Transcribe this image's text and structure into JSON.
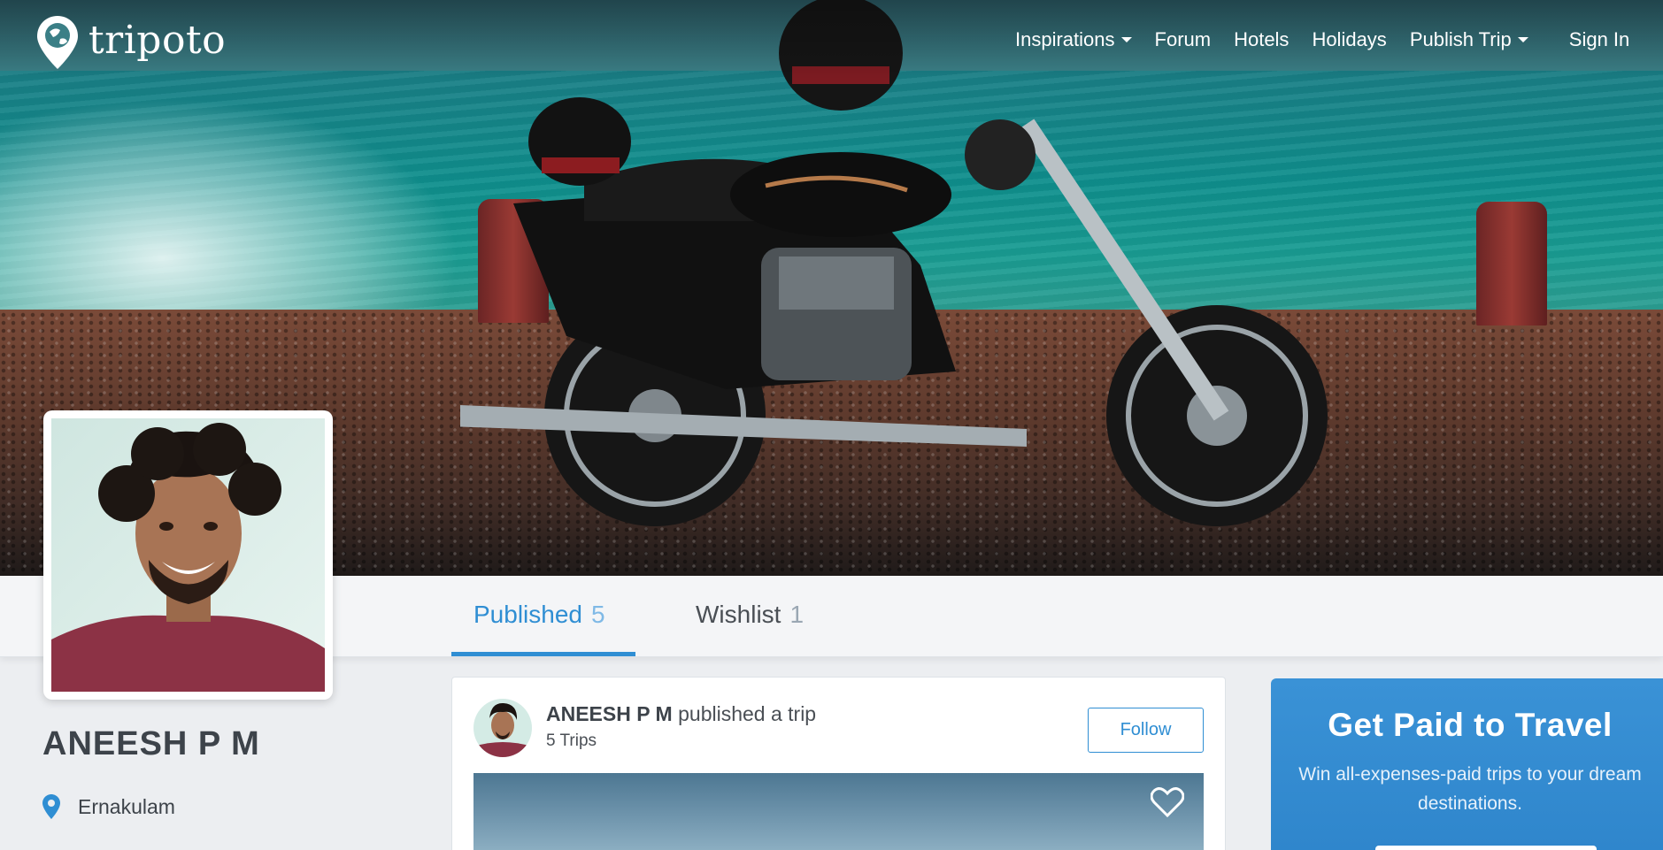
{
  "brand": {
    "name": "tripoto"
  },
  "nav": {
    "links": [
      {
        "label": "Inspirations",
        "dropdown": true
      },
      {
        "label": "Forum",
        "dropdown": false
      },
      {
        "label": "Hotels",
        "dropdown": false
      },
      {
        "label": "Holidays",
        "dropdown": false
      },
      {
        "label": "Publish Trip",
        "dropdown": true
      },
      {
        "label": "Sign In",
        "dropdown": false
      }
    ]
  },
  "profile": {
    "name": "ANEESH P M",
    "location": "Ernakulam"
  },
  "tabs": [
    {
      "label": "Published",
      "count": "5",
      "active": true
    },
    {
      "label": "Wishlist",
      "count": "1",
      "active": false
    }
  ],
  "feed": {
    "author": "ANEESH P M",
    "action": "published a trip",
    "trips": "5 Trips",
    "follow_label": "Follow"
  },
  "promo": {
    "title": "Get Paid to Travel",
    "subtitle": "Win all-expenses-paid trips to your dream destinations."
  },
  "colors": {
    "accent": "#2f8ed3",
    "promo_bg": "#3a92d6",
    "text": "#3d434a"
  },
  "icons": [
    "tripoto-logo-icon",
    "caret-down-icon",
    "location-pin-icon",
    "heart-icon"
  ]
}
